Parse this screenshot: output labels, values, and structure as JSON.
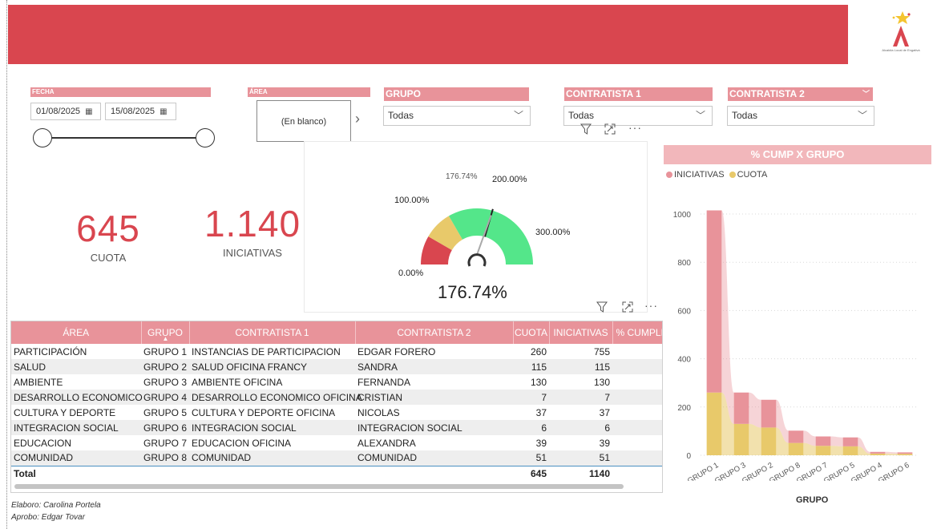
{
  "colors": {
    "brand": "#d9464f",
    "header_pink": "#e8939a",
    "gauge_red": "#d9464f",
    "gauge_yellow": "#e8c96a",
    "gauge_green": "#54e68a",
    "cuota": "#e8c96a",
    "iniciativas": "#e8939a"
  },
  "logo": {
    "text": "Alcaldía Local de Engativá"
  },
  "filters": {
    "fecha": {
      "label": "FECHA",
      "start": "01/08/2025",
      "end": "15/08/2025"
    },
    "area": {
      "label": "ÁREA",
      "value": "(En blanco)"
    },
    "grupo": {
      "label": "GRUPO",
      "value": "Todas"
    },
    "contratista1": {
      "label": "CONTRATISTA 1",
      "value": "Todas"
    },
    "contratista2": {
      "label": "CONTRATISTA 2",
      "value": "Todas"
    }
  },
  "kpis": {
    "cuota": {
      "value": "645",
      "label": "CUOTA"
    },
    "iniciativas": {
      "value": "1.140",
      "label": "INICIATIVAS"
    }
  },
  "gauge": {
    "value": 176.74,
    "value_label": "176.74%",
    "pointer_label": "176.74%",
    "min_label": "0.00%",
    "t100_label": "100.00%",
    "t200_label": "200.00%",
    "max_label": "300.00%",
    "max": 300
  },
  "table": {
    "columns": [
      "ÁREA",
      "GRUPO",
      "CONTRATISTA 1",
      "CONTRATISTA 2",
      "CUOTA",
      "INICIATIVAS",
      "% CUMPLI"
    ],
    "rows": [
      [
        "PARTICIPACIÓN",
        "GRUPO 1",
        "INSTANCIAS DE PARTICIPACION",
        "EDGAR FORERO",
        "260",
        "755"
      ],
      [
        "SALUD",
        "GRUPO 2",
        "SALUD OFICINA FRANCY",
        "SANDRA",
        "115",
        "115"
      ],
      [
        "AMBIENTE",
        "GRUPO 3",
        "AMBIENTE OFICINA",
        "FERNANDA",
        "130",
        "130"
      ],
      [
        "DESARROLLO ECONOMICO",
        "GRUPO 4",
        "DESARROLLO ECONOMICO OFICINA",
        "CRISTIAN",
        "7",
        "7"
      ],
      [
        "CULTURA Y DEPORTE",
        "GRUPO 5",
        "CULTURA Y DEPORTE OFICINA",
        "NICOLAS",
        "37",
        "37"
      ],
      [
        "INTEGRACION SOCIAL",
        "GRUPO 6",
        "INTEGRACION SOCIAL",
        "INTEGRACION SOCIAL",
        "6",
        "6"
      ],
      [
        "EDUCACION",
        "GRUPO 7",
        "EDUCACION OFICINA",
        "ALEXANDRA",
        "39",
        "39"
      ],
      [
        "COMUNIDAD",
        "GRUPO 8",
        "COMUNIDAD",
        "COMUNIDAD",
        "51",
        "51"
      ]
    ],
    "total": {
      "label": "Total",
      "cuota": "645",
      "iniciativas": "1140"
    }
  },
  "footer": {
    "elaboro": "Elaboro: Carolina Portela",
    "aprobo": "Aprobo: Edgar Tovar"
  },
  "chart_data": {
    "type": "area",
    "title": "% CUMP X GRUPO",
    "xlabel": "GRUPO",
    "ylabel": "",
    "categories": [
      "GRUPO 1",
      "GRUPO 3",
      "GRUPO 2",
      "GRUPO 8",
      "GRUPO 7",
      "GRUPO 5",
      "GRUPO 4",
      "GRUPO 6"
    ],
    "series": [
      {
        "name": "INICIATIVAS",
        "values": [
          755,
          130,
          115,
          51,
          39,
          37,
          7,
          6
        ]
      },
      {
        "name": "CUOTA",
        "values": [
          260,
          130,
          115,
          51,
          39,
          37,
          7,
          6
        ]
      }
    ],
    "yticks": [
      "0",
      "200",
      "400",
      "600",
      "800",
      "1000"
    ],
    "ylim": [
      0,
      1000
    ],
    "legend": "top-left",
    "grid": true
  }
}
